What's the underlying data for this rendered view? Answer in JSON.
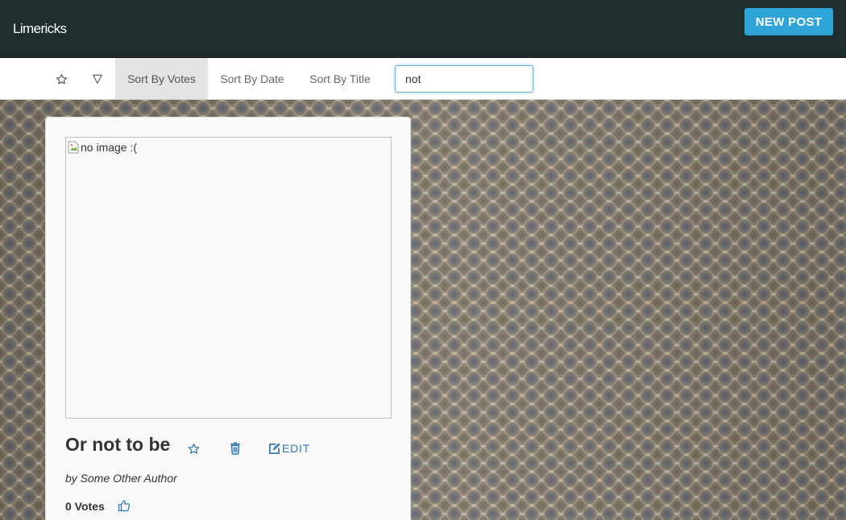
{
  "header": {
    "brand": "Limericks",
    "new_post_label": "NEW POST"
  },
  "toolbar": {
    "favorites_icon": "star-outline-icon",
    "filter_icon": "filter-triangle-icon",
    "sort_options": [
      {
        "label": "Sort By Votes",
        "active": true
      },
      {
        "label": "Sort By Date",
        "active": false
      },
      {
        "label": "Sort By Title",
        "active": false
      }
    ],
    "search_value": "not"
  },
  "post": {
    "image_alt": "no image :(",
    "title": "Or not to be",
    "author": "by Some Other Author",
    "votes": "0 Votes",
    "edit_label": "EDIT",
    "icons": {
      "favorite": "star-outline-icon",
      "delete": "trash-icon",
      "edit": "edit-icon",
      "upvote": "thumbs-up-icon"
    }
  },
  "colors": {
    "header_bg": "#1f2f2f",
    "accent": "#2fa4d7",
    "link": "#337ab7",
    "active_sort_bg": "#e3e3e3"
  }
}
